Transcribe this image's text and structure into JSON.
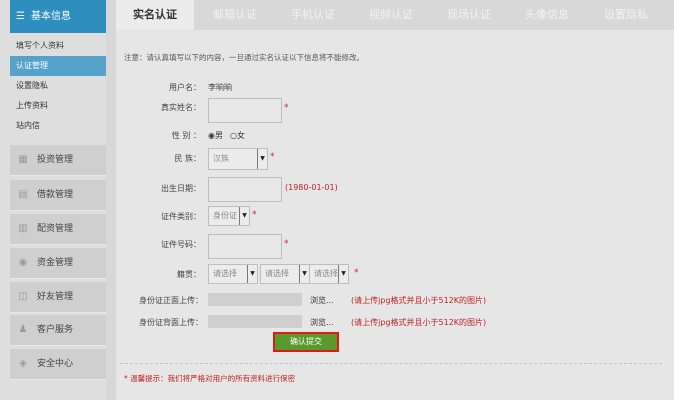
{
  "sidebar": {
    "header": "基本信息",
    "sub_items": [
      {
        "label": "填写个人资料",
        "active": false
      },
      {
        "label": "认证管理",
        "active": true
      },
      {
        "label": "设置隐私",
        "active": false
      },
      {
        "label": "上传资料",
        "active": false
      },
      {
        "label": "站内信",
        "active": false
      }
    ],
    "groups": [
      {
        "label": "投资管理",
        "icon": "grid-icon"
      },
      {
        "label": "借款管理",
        "icon": "calculator-icon"
      },
      {
        "label": "配资管理",
        "icon": "document-icon"
      },
      {
        "label": "资金管理",
        "icon": "coins-icon"
      },
      {
        "label": "好友管理",
        "icon": "friends-icon"
      },
      {
        "label": "客户服务",
        "icon": "users-icon"
      },
      {
        "label": "安全中心",
        "icon": "shield-icon"
      }
    ]
  },
  "tabs": [
    {
      "label": "实名认证",
      "active": true
    },
    {
      "label": "邮箱认证",
      "active": false
    },
    {
      "label": "手机认证",
      "active": false
    },
    {
      "label": "视频认证",
      "active": false
    },
    {
      "label": "现场认证",
      "active": false
    },
    {
      "label": "头像信息",
      "active": false
    },
    {
      "label": "设置隐私",
      "active": false
    }
  ],
  "form": {
    "notice": "注意：请认真填写以下的内容，一旦通过实名认证以下信息将不能修改。",
    "username_label": "用户名：",
    "username_value": "李晌晌",
    "realname_label": "真实姓名：",
    "gender_label": "性 别 ：",
    "gender_male": "男",
    "gender_female": "女",
    "ethnicity_label": "民 族：",
    "ethnicity_value": "汉族",
    "birth_label": "出生日期：",
    "birth_hint": "(1980-01-01)",
    "idtype_label": "证件类别：",
    "idtype_value": "身份证",
    "idnum_label": "证件号码：",
    "native_label": "籍贯：",
    "native_select1": "请选择",
    "native_select2": "请选择",
    "native_select3": "请选择",
    "front_label": "身份证正面上传：",
    "back_label": "身份证背面上传：",
    "browse_label": "浏览...",
    "upload_hint": "(请上传jpg格式并且小于512K的图片)",
    "required_mark": "*",
    "submit_label": "确认提交",
    "warm_tip": "* 温馨提示：我们将严格对用户的所有资料进行保密"
  }
}
